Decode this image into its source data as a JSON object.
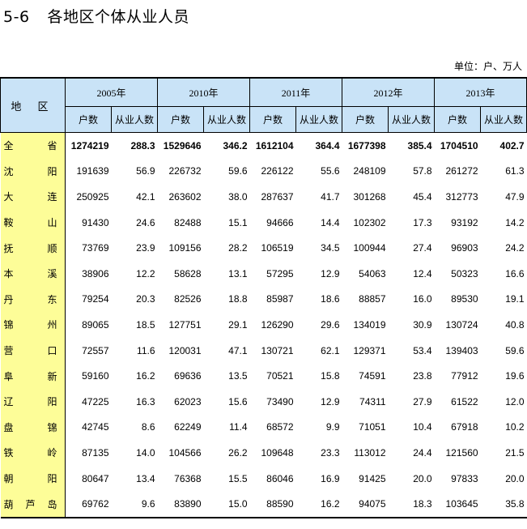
{
  "title": {
    "number": "5-6",
    "text": "各地区个体从业人员"
  },
  "unit": "单位：户、万人",
  "header": {
    "region": "地 区",
    "years": [
      "2005年",
      "2010年",
      "2011年",
      "2012年",
      "2013年"
    ],
    "households": "户数",
    "employees": "从业人数"
  },
  "rows": [
    {
      "name": "全 省",
      "values": [
        "1274219",
        "288.3",
        "1529646",
        "346.2",
        "1612104",
        "364.4",
        "1677398",
        "385.4",
        "1704510",
        "402.7"
      ]
    },
    {
      "name": "沈 阳",
      "values": [
        "191639",
        "56.9",
        "226732",
        "59.6",
        "226122",
        "55.6",
        "248109",
        "57.8",
        "261272",
        "61.3"
      ]
    },
    {
      "name": "大 连",
      "values": [
        "250925",
        "42.1",
        "263602",
        "38.0",
        "287637",
        "41.7",
        "301268",
        "45.4",
        "312773",
        "47.9"
      ]
    },
    {
      "name": "鞍 山",
      "values": [
        "91430",
        "24.6",
        "82488",
        "15.1",
        "94666",
        "14.4",
        "102302",
        "17.3",
        "93192",
        "14.2"
      ]
    },
    {
      "name": "抚 顺",
      "values": [
        "73769",
        "23.9",
        "109156",
        "28.2",
        "106519",
        "34.5",
        "100944",
        "27.4",
        "96903",
        "24.2"
      ]
    },
    {
      "name": "本 溪",
      "values": [
        "38906",
        "12.2",
        "58628",
        "13.1",
        "57295",
        "12.9",
        "54063",
        "12.4",
        "50323",
        "16.6"
      ]
    },
    {
      "name": "丹 东",
      "values": [
        "79254",
        "20.3",
        "82526",
        "18.8",
        "85987",
        "18.6",
        "88857",
        "16.0",
        "89530",
        "19.1"
      ]
    },
    {
      "name": "锦 州",
      "values": [
        "89065",
        "18.5",
        "127751",
        "29.1",
        "126290",
        "29.6",
        "134019",
        "30.9",
        "130724",
        "40.8"
      ]
    },
    {
      "name": "营 口",
      "values": [
        "72557",
        "11.6",
        "120031",
        "47.1",
        "130721",
        "62.1",
        "129371",
        "53.4",
        "139403",
        "59.6"
      ]
    },
    {
      "name": "阜 新",
      "values": [
        "59160",
        "16.2",
        "69636",
        "13.5",
        "70521",
        "15.8",
        "74591",
        "23.8",
        "77912",
        "19.6"
      ]
    },
    {
      "name": "辽 阳",
      "values": [
        "47225",
        "16.3",
        "62023",
        "15.6",
        "73490",
        "12.9",
        "74311",
        "27.9",
        "61522",
        "12.0"
      ]
    },
    {
      "name": "盘 锦",
      "values": [
        "42745",
        "8.6",
        "62249",
        "11.4",
        "68572",
        "9.9",
        "71051",
        "10.4",
        "67918",
        "10.2"
      ]
    },
    {
      "name": "铁 岭",
      "values": [
        "87135",
        "14.0",
        "104566",
        "26.2",
        "109648",
        "23.3",
        "113012",
        "24.4",
        "121560",
        "21.5"
      ]
    },
    {
      "name": "朝 阳",
      "values": [
        "80647",
        "13.4",
        "76368",
        "15.5",
        "86046",
        "16.9",
        "91425",
        "20.0",
        "97833",
        "20.0"
      ]
    },
    {
      "name": "葫芦岛",
      "values": [
        "69762",
        "9.6",
        "83890",
        "15.0",
        "88590",
        "16.2",
        "94075",
        "18.3",
        "103645",
        "35.8"
      ]
    }
  ]
}
